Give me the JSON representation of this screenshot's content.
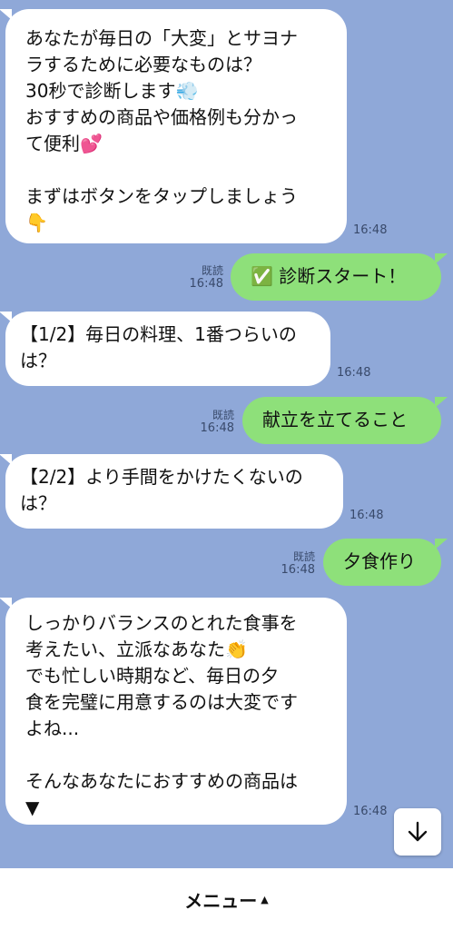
{
  "messages": [
    {
      "dir": "in",
      "lines": [
        "あなたが毎日の「大変」とサヨナ",
        "ラするために必要なものは？",
        "30秒で診断します💨",
        "おすすめの商品や価格例も分かっ",
        "て便利💕",
        "",
        "まずはボタンをタップしましょう",
        "👇"
      ],
      "time": "16:48"
    },
    {
      "dir": "out",
      "text": "✅ 診断スタート！",
      "read": "既読",
      "time": "16:48"
    },
    {
      "dir": "in",
      "lines": [
        "【1/2】毎日の料理、1番つらいの",
        "は？"
      ],
      "time": "16:48"
    },
    {
      "dir": "out",
      "text": "献立を立てること",
      "read": "既読",
      "time": "16:48"
    },
    {
      "dir": "in",
      "lines": [
        "【2/2】より手間をかけたくないの",
        "は？"
      ],
      "time": "16:48"
    },
    {
      "dir": "out",
      "text": "夕食作り",
      "read": "既読",
      "time": "16:48"
    },
    {
      "dir": "in",
      "lines": [
        "しっかりバランスのとれた食事を",
        "考えたい、立派なあなた👏",
        "でも忙しい時期など、毎日の夕",
        "食を完璧に用意するのは大変です",
        "よね...",
        "",
        "そんなあなたにおすすめの商品は",
        "▼"
      ],
      "time": "16:48"
    }
  ],
  "menu": {
    "label": "メニュー",
    "caret": "▲"
  },
  "icons": {
    "scroll": "arrow-down-icon",
    "caret": "caret-up-icon"
  },
  "colors": {
    "background": "#8fa8d8",
    "incoming": "#ffffff",
    "outgoing": "#8ee07a"
  }
}
